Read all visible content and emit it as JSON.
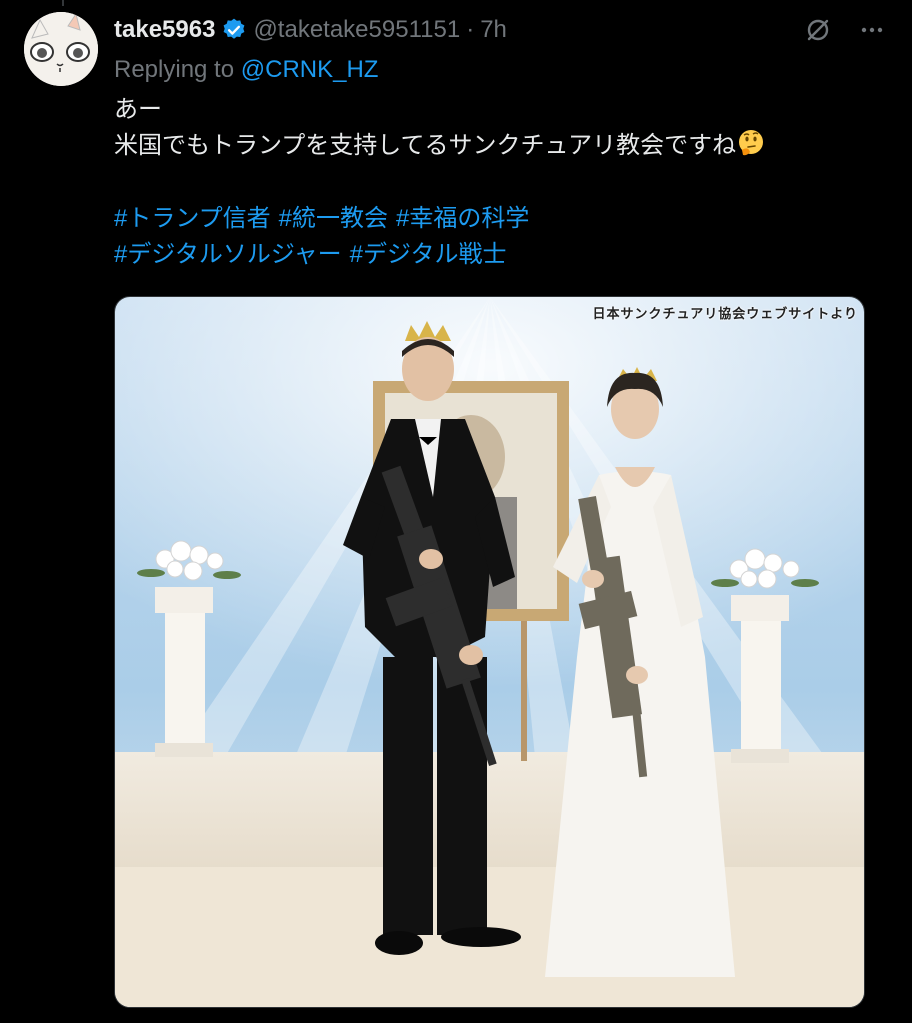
{
  "tweet": {
    "display_name": "take5963",
    "handle": "@taketake5951151",
    "separator": "·",
    "time": "7h",
    "reply_prefix": "Replying to",
    "reply_to": "@CRNK_HZ",
    "lines": [
      "あー",
      "米国でもトランプを支持してるサンクチュアリ教会ですね"
    ],
    "emoji": "thinking-face-icon",
    "hashtag_rows": [
      [
        "#トランプ信者",
        "#統一教会",
        "#幸福の科学"
      ],
      [
        "#デジタルソルジャー",
        "#デジタル戦士"
      ]
    ],
    "image_caption": "日本サンクチュアリ協会ウェブサイトより"
  },
  "colors": {
    "background": "#000000",
    "text": "#e7e9ea",
    "muted": "#71767b",
    "accent": "#1d9bf0"
  }
}
